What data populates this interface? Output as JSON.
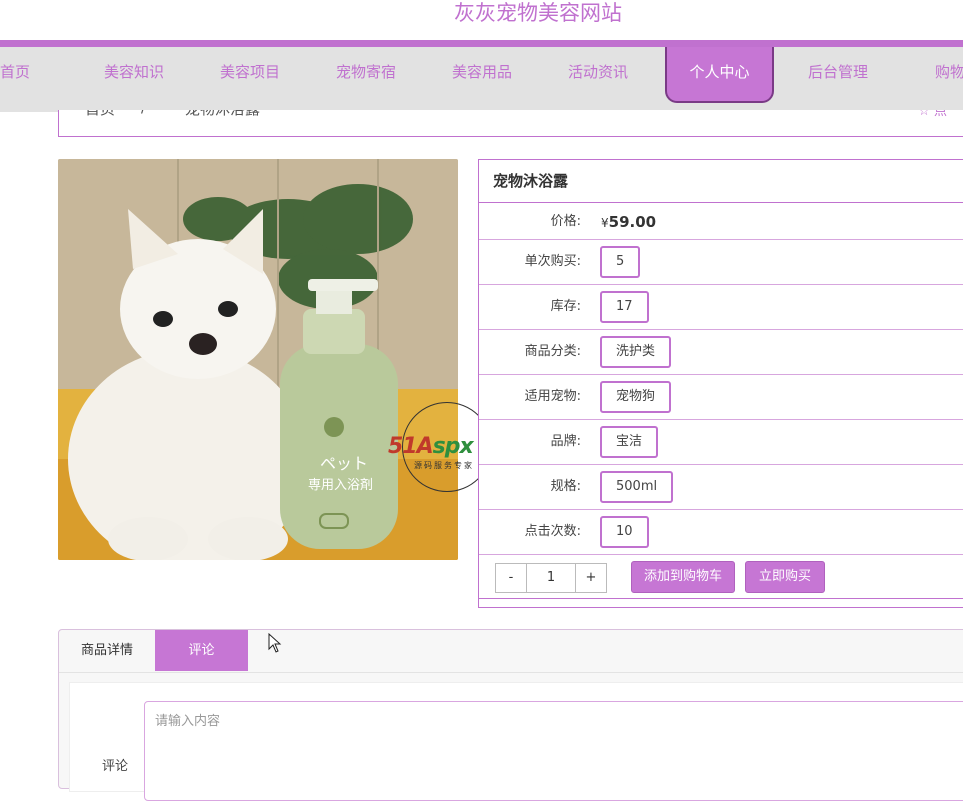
{
  "site": {
    "title": "灰灰宠物美容网站"
  },
  "nav": {
    "items": [
      {
        "label": "首页"
      },
      {
        "label": "美容知识"
      },
      {
        "label": "美容项目"
      },
      {
        "label": "宠物寄宿"
      },
      {
        "label": "美容用品"
      },
      {
        "label": "活动资讯"
      },
      {
        "label": "个人中心",
        "active": true
      },
      {
        "label": "后台管理"
      },
      {
        "label": "购物车"
      }
    ]
  },
  "breadcrumb": {
    "home": "首页",
    "separator": "/",
    "current": "宠物沐浴露",
    "right": "☆ 点"
  },
  "product": {
    "name": "宠物沐浴露",
    "price_label": "价格:",
    "currency": "¥",
    "price": "59.00",
    "fields": [
      {
        "label": "单次购买:",
        "value": "5"
      },
      {
        "label": "库存:",
        "value": "17"
      },
      {
        "label": "商品分类:",
        "value": "洗护类"
      },
      {
        "label": "适用宠物:",
        "value": "宠物狗"
      },
      {
        "label": "品牌:",
        "value": "宝洁"
      },
      {
        "label": "规格:",
        "value": "500ml"
      },
      {
        "label": "点击次数:",
        "value": "10"
      }
    ],
    "image_alt": "pomeranian-with-shampoo-bottle",
    "bottle_text": "ペット 専用入浴剤"
  },
  "quantity": {
    "minus": "-",
    "value": "1",
    "plus": "+"
  },
  "actions": {
    "add_to_cart": "添加到购物车",
    "buy_now": "立即购买"
  },
  "watermark": {
    "logo_a": "51A",
    "logo_b": "spx",
    "sub": "源码服务专家"
  },
  "tabs": {
    "details": "商品详情",
    "comments": "评论"
  },
  "comment": {
    "label": "评论",
    "placeholder": "请输入内容"
  },
  "colors": {
    "accent": "#c071cf",
    "active_bg": "#c676d4",
    "nav_bg": "#e2e2e2"
  }
}
